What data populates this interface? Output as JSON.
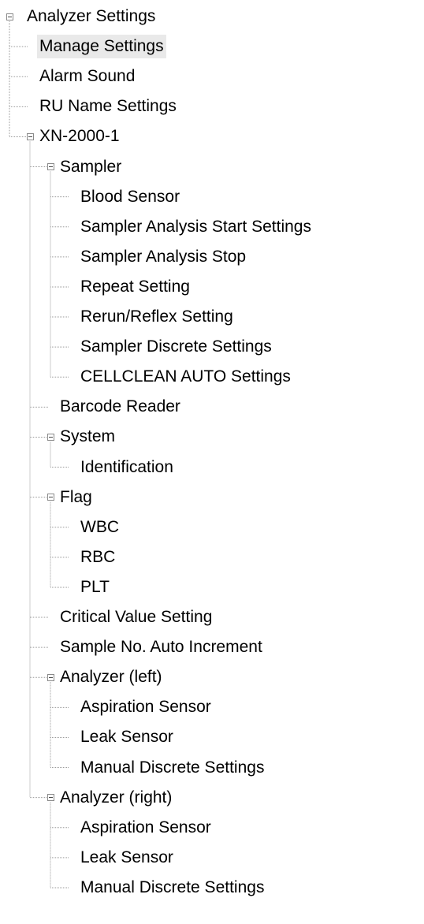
{
  "tree": {
    "root": {
      "label": "Analyzer Settings",
      "state": "expanded",
      "children": [
        {
          "label": "Manage Settings",
          "selected": true
        },
        {
          "label": "Alarm Sound"
        },
        {
          "label": "RU Name Settings"
        },
        {
          "label": "XN-2000-1",
          "state": "expanded",
          "children": [
            {
              "label": "Sampler",
              "state": "expanded",
              "children": [
                {
                  "label": "Blood Sensor"
                },
                {
                  "label": "Sampler Analysis Start Settings"
                },
                {
                  "label": "Sampler Analysis Stop"
                },
                {
                  "label": "Repeat Setting"
                },
                {
                  "label": "Rerun/Reflex Setting"
                },
                {
                  "label": "Sampler Discrete Settings"
                },
                {
                  "label": "CELLCLEAN AUTO Settings"
                }
              ]
            },
            {
              "label": "Barcode Reader"
            },
            {
              "label": "System",
              "state": "expanded",
              "children": [
                {
                  "label": "Identification"
                }
              ]
            },
            {
              "label": "Flag",
              "state": "expanded",
              "children": [
                {
                  "label": "WBC"
                },
                {
                  "label": "RBC"
                },
                {
                  "label": "PLT"
                }
              ]
            },
            {
              "label": "Critical Value Setting"
            },
            {
              "label": "Sample No. Auto Increment"
            },
            {
              "label": "Analyzer (left)",
              "state": "expanded",
              "children": [
                {
                  "label": "Aspiration Sensor"
                },
                {
                  "label": "Leak Sensor"
                },
                {
                  "label": "Manual Discrete Settings"
                }
              ]
            },
            {
              "label": "Analyzer (right)",
              "state": "expanded",
              "children": [
                {
                  "label": "Aspiration Sensor"
                },
                {
                  "label": "Leak Sensor"
                },
                {
                  "label": "Manual Discrete Settings"
                }
              ]
            }
          ]
        }
      ]
    }
  }
}
